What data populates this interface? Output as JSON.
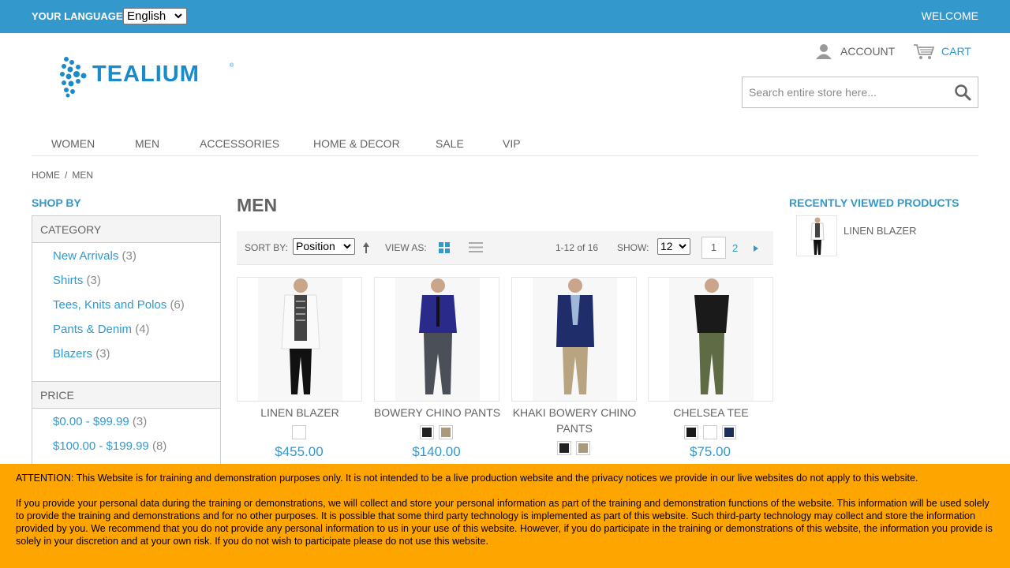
{
  "topbar": {
    "language_label": "YOUR LANGUAGE:",
    "language_value": "English",
    "welcome": "WELCOME"
  },
  "header": {
    "logo_text": "TEALIUM",
    "logo_tm": "®",
    "account": "ACCOUNT",
    "cart": "CART",
    "search_placeholder": "Search entire store here..."
  },
  "nav": {
    "items": [
      "WOMEN",
      "MEN",
      "ACCESSORIES",
      "HOME & DECOR",
      "SALE",
      "VIP"
    ]
  },
  "breadcrumb": {
    "home": "HOME",
    "separator": "/",
    "current": "MEN"
  },
  "sidebar": {
    "title": "SHOP BY",
    "category": {
      "heading": "CATEGORY",
      "items": [
        {
          "label": "New Arrivals",
          "count": "(3)"
        },
        {
          "label": "Shirts",
          "count": "(3)"
        },
        {
          "label": "Tees, Knits and Polos",
          "count": "(6)"
        },
        {
          "label": "Pants & Denim",
          "count": "(4)"
        },
        {
          "label": "Blazers",
          "count": "(3)"
        }
      ]
    },
    "price": {
      "heading": "PRICE",
      "items": [
        {
          "label": "$0.00 - $99.99",
          "count": "(3)"
        },
        {
          "label": "$100.00 - $199.99",
          "count": "(8)"
        }
      ]
    }
  },
  "main": {
    "title": "MEN",
    "toolbar": {
      "sort_label": "SORT BY:",
      "sort_value": "Position",
      "view_label": "VIEW AS:",
      "count": "1-12 of 16",
      "show_label": "SHOW:",
      "show_value": "12",
      "page_current": "1",
      "page_next": "2"
    },
    "products": [
      {
        "name": "LINEN BLAZER",
        "price": "$455.00",
        "swatches": [
          "#ffffff"
        ]
      },
      {
        "name": "BOWERY CHINO PANTS",
        "price": "$140.00",
        "swatches": [
          "#222222",
          "#a89a7a"
        ]
      },
      {
        "name": "KHAKI BOWERY CHINO PANTS",
        "price": "",
        "swatches": [
          "#222222",
          "#a89a7a"
        ]
      },
      {
        "name": "CHELSEA TEE",
        "price": "$75.00",
        "swatches": [
          "#1a1a1a",
          "#ffffff",
          "#1f2d5c"
        ]
      }
    ]
  },
  "recently_viewed": {
    "title": "RECENTLY VIEWED PRODUCTS",
    "item": "LINEN BLAZER"
  },
  "notice": {
    "p1": "ATTENTION: This Website is for training and demonstration purposes only. It is not intended to be a live production website and the privacy notices we provide in our live websites do not apply to this website.",
    "p2": "If you provide your personal data during the training or demonstrations, we will collect and store your personal information as part of the training and demonstration functions of the website. This information will be used solely to provide the training and demonstrations and for no other purposes. It is possible that some third party technology is implemented as part of this website. Such third-party technology may collect and store the information provided by you. We recommend that you do not provide any personal information to us in your use of this website. However, if you do participate in the training or demonstrations of this website, the information you provide is solely in your discretion and at your own risk. If you do not wish to participate please do not use this website."
  },
  "colors": {
    "accent": "#3399cc",
    "notice_bg": "#ffa500",
    "text": "#636363"
  }
}
